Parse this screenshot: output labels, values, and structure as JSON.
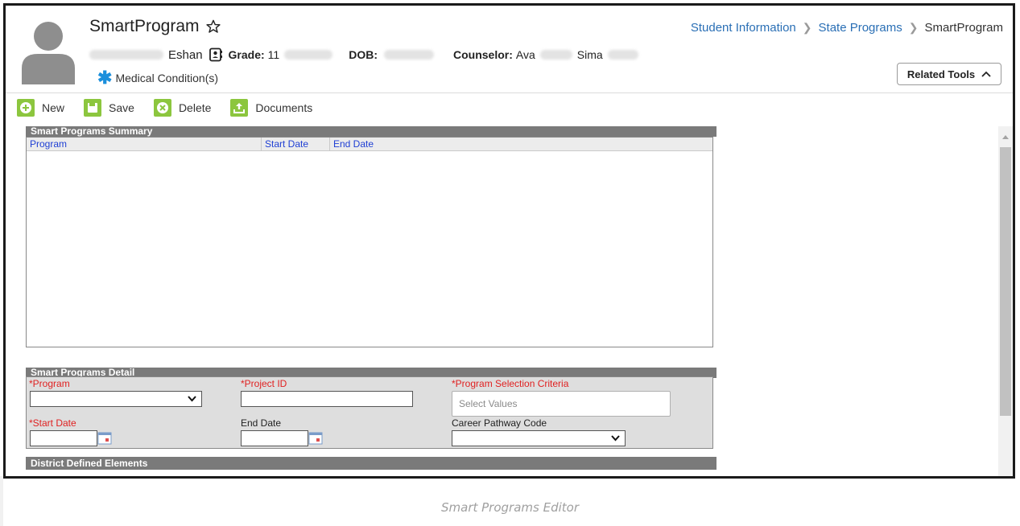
{
  "header": {
    "title": "SmartProgram",
    "student_first_name": "Eshan",
    "grade_label": "Grade:",
    "grade_value": "11",
    "dob_label": "DOB:",
    "counselor_label": "Counselor:",
    "counselor_first": "Ava",
    "counselor_middle": "Sima",
    "medical_label": "Medical Condition(s)"
  },
  "breadcrumb": {
    "items": [
      "Student Information",
      "State Programs",
      "SmartProgram"
    ]
  },
  "related_tools": {
    "label": "Related Tools"
  },
  "toolbar": {
    "new_label": "New",
    "save_label": "Save",
    "delete_label": "Delete",
    "documents_label": "Documents"
  },
  "summary": {
    "title": "Smart Programs Summary",
    "columns": [
      "Program",
      "Start Date",
      "End Date"
    ]
  },
  "detail": {
    "title": "Smart Programs Detail",
    "program_label": "*Program",
    "project_id_label": "*Project ID",
    "selection_criteria_label": "*Program Selection Criteria",
    "selection_criteria_placeholder": "Select Values",
    "start_date_label": "*Start Date",
    "end_date_label": "End Date",
    "career_pathway_label": "Career Pathway Code"
  },
  "district": {
    "title": "District Defined Elements"
  },
  "caption": "Smart Programs Editor",
  "colors": {
    "accent_green": "#8cc63e",
    "link_blue": "#2a6fb5",
    "required_red": "#e02121",
    "panel_header_gray": "#7a7a7a",
    "column_header_blue": "#1f3fd4"
  }
}
